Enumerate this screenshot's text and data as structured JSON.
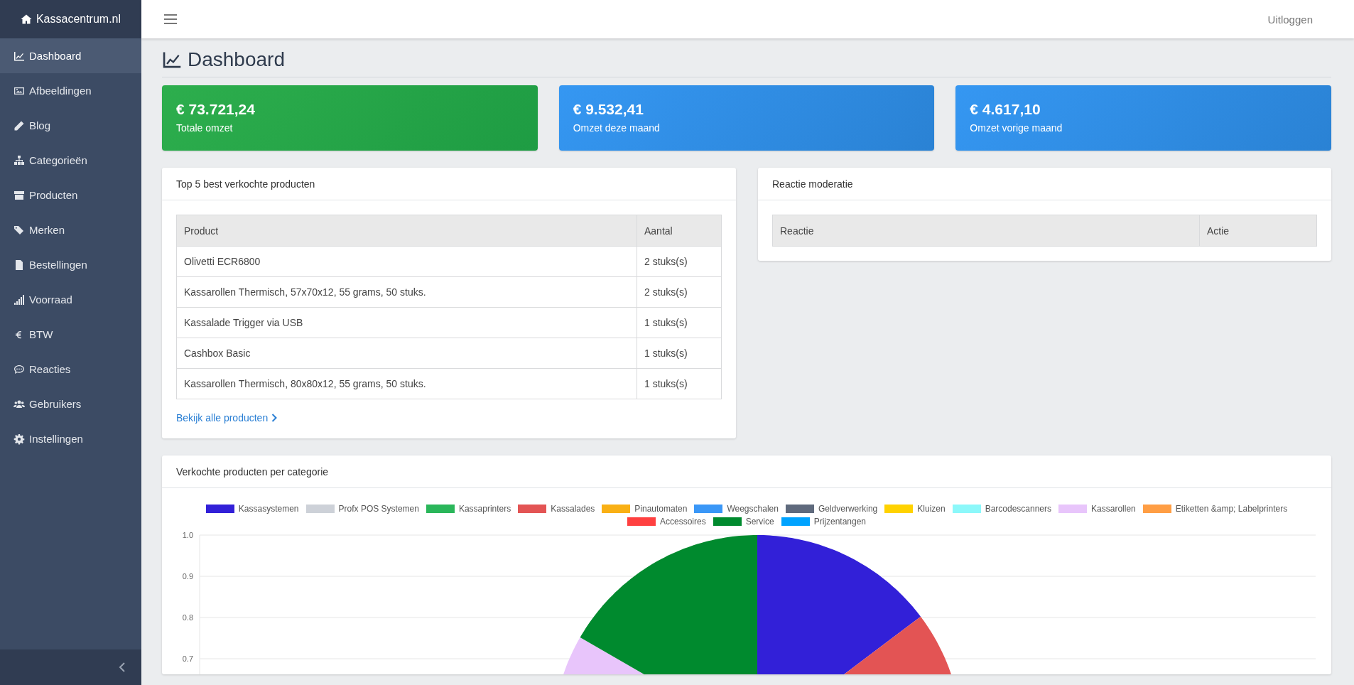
{
  "brand": "Kassacentrum.nl",
  "sidebar": {
    "items": [
      {
        "label": "Dashboard",
        "selected": true
      },
      {
        "label": "Afbeeldingen",
        "selected": false
      },
      {
        "label": "Blog",
        "selected": false
      },
      {
        "label": "Categorieën",
        "selected": false
      },
      {
        "label": "Producten",
        "selected": false
      },
      {
        "label": "Merken",
        "selected": false
      },
      {
        "label": "Bestellingen",
        "selected": false
      },
      {
        "label": "Voorraad",
        "selected": false
      },
      {
        "label": "BTW",
        "selected": false
      },
      {
        "label": "Reacties",
        "selected": false
      },
      {
        "label": "Gebruikers",
        "selected": false
      },
      {
        "label": "Instellingen",
        "selected": false
      }
    ]
  },
  "topbar": {
    "logout": "Uitloggen"
  },
  "page_title": "Dashboard",
  "stats": [
    {
      "value": "€ 73.721,24",
      "label": "Totale omzet",
      "kind": "success"
    },
    {
      "value": "€ 9.532,41",
      "label": "Omzet deze maand",
      "kind": "primary"
    },
    {
      "value": "€ 4.617,10",
      "label": "Omzet vorige maand",
      "kind": "primary"
    }
  ],
  "top_products": {
    "title": "Top 5 best verkochte producten",
    "columns": [
      "Product",
      "Aantal"
    ],
    "rows": [
      [
        "Olivetti ECR6800",
        "2 stuks(s)"
      ],
      [
        "Kassarollen Thermisch, 57x70x12, 55 grams, 50 stuks.",
        "2 stuks(s)"
      ],
      [
        "Kassalade Trigger via USB",
        "1 stuks(s)"
      ],
      [
        "Cashbox Basic",
        "1 stuks(s)"
      ],
      [
        "Kassarollen Thermisch, 80x80x12, 55 grams, 50 stuks.",
        "1 stuks(s)"
      ]
    ],
    "link": "Bekijk alle producten"
  },
  "moderation": {
    "title": "Reactie moderatie",
    "columns": [
      "Reactie",
      "Actie"
    ]
  },
  "category_chart": {
    "title": "Verkochte producten per categorie",
    "legend": [
      {
        "name": "Kassasystemen",
        "color": "#3220d8"
      },
      {
        "name": "Profx POS Systemen",
        "color": "#cdd1d8"
      },
      {
        "name": "Kassaprinters",
        "color": "#2ab65a"
      },
      {
        "name": "Kassalades",
        "color": "#e35454"
      },
      {
        "name": "Pinautomaten",
        "color": "#f9b015"
      },
      {
        "name": "Weegschalen",
        "color": "#3a97f7"
      },
      {
        "name": "Geldverwerking",
        "color": "#5f6a7d"
      },
      {
        "name": "Kluizen",
        "color": "#ffd200"
      },
      {
        "name": "Barcodescanners",
        "color": "#8cf8fa"
      },
      {
        "name": "Kassarollen",
        "color": "#e8c5fb"
      },
      {
        "name": "Etiketten &amp; Labelprinters",
        "color": "#ff9e44"
      },
      {
        "name": "Accessoires",
        "color": "#ff4040"
      },
      {
        "name": "Service",
        "color": "#008a2e"
      },
      {
        "name": "Prijzentangen",
        "color": "#00a3ff"
      }
    ],
    "yticks": [
      "1.0",
      "0.9",
      "0.8",
      "0.7"
    ]
  }
}
